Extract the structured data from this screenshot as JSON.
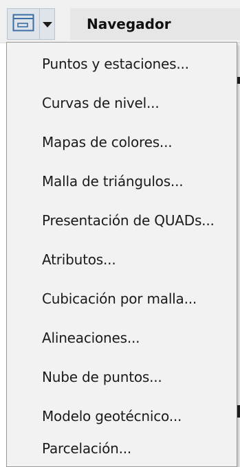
{
  "toolbar": {
    "view_button": {
      "icon": "window-icon",
      "dropdown_icon": "caret-down-icon"
    },
    "navigator_title": "Navegador"
  },
  "menu": {
    "items": [
      {
        "label": "Puntos y estaciones..."
      },
      {
        "label": "Curvas de nivel..."
      },
      {
        "label": "Mapas de colores..."
      },
      {
        "label": "Malla de triángulos..."
      },
      {
        "label": "Presentación de QUADs..."
      },
      {
        "label": "Atributos..."
      },
      {
        "label": "Cubicación por malla..."
      },
      {
        "label": "Alineaciones..."
      },
      {
        "label": "Nube de puntos..."
      },
      {
        "label": "Modelo geotécnico..."
      },
      {
        "label": "Parcelación..."
      }
    ]
  },
  "colors": {
    "button_bg": "#dfe4ea",
    "icon_stroke": "#3a6ea5",
    "menu_bg": "#f2f2f2"
  }
}
